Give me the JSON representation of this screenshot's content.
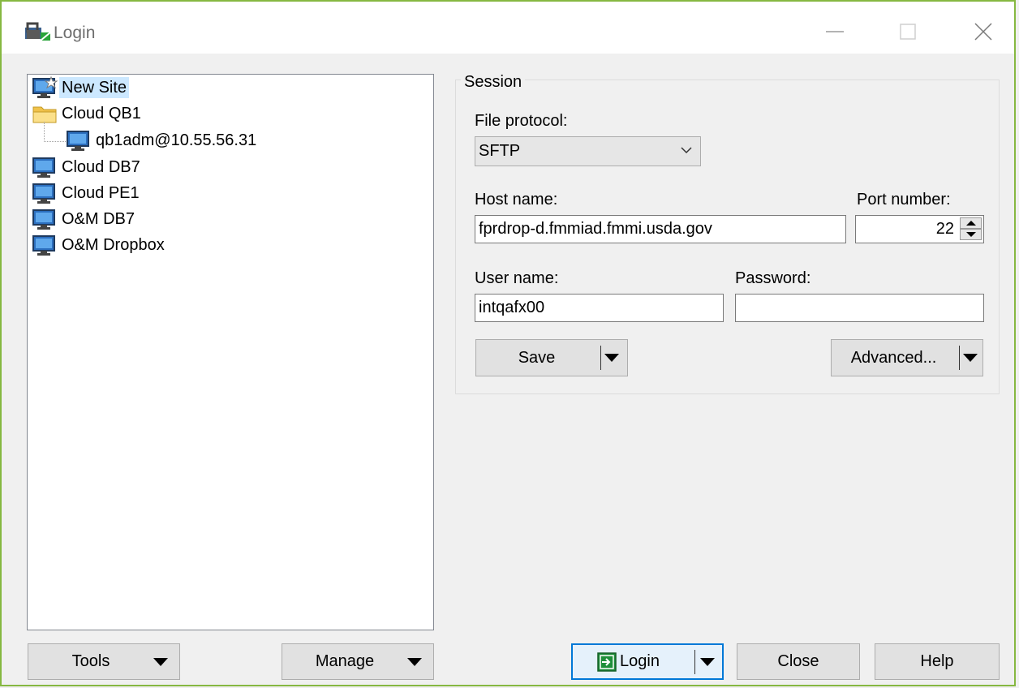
{
  "window": {
    "title": "Login"
  },
  "tree": {
    "items": [
      {
        "label": "New Site",
        "icon": "new-site-icon"
      },
      {
        "label": "Cloud QB1",
        "icon": "folder-icon"
      },
      {
        "label": "qb1adm@10.55.56.31",
        "icon": "monitor-icon"
      },
      {
        "label": "Cloud DB7",
        "icon": "monitor-icon"
      },
      {
        "label": "Cloud PE1",
        "icon": "monitor-icon"
      },
      {
        "label": "O&M DB7",
        "icon": "monitor-icon"
      },
      {
        "label": "O&M Dropbox",
        "icon": "monitor-icon"
      }
    ]
  },
  "session": {
    "group_title": "Session",
    "file_protocol_label": "File protocol:",
    "file_protocol_value": "SFTP",
    "host_label": "Host name:",
    "host_value": "fprdrop-d.fmmiad.fmmi.usda.gov",
    "port_label": "Port number:",
    "port_value": "22",
    "user_label": "User name:",
    "user_value": "intqafx00",
    "password_label": "Password:",
    "password_value": "",
    "save_label": "Save",
    "advanced_label": "Advanced..."
  },
  "bottom": {
    "tools_label": "Tools",
    "manage_label": "Manage",
    "login_label": "Login",
    "close_label": "Close",
    "help_label": "Help"
  },
  "colors": {
    "window_border": "#86b841",
    "selection": "#cce8ff",
    "login_focus": "#0078d7"
  }
}
